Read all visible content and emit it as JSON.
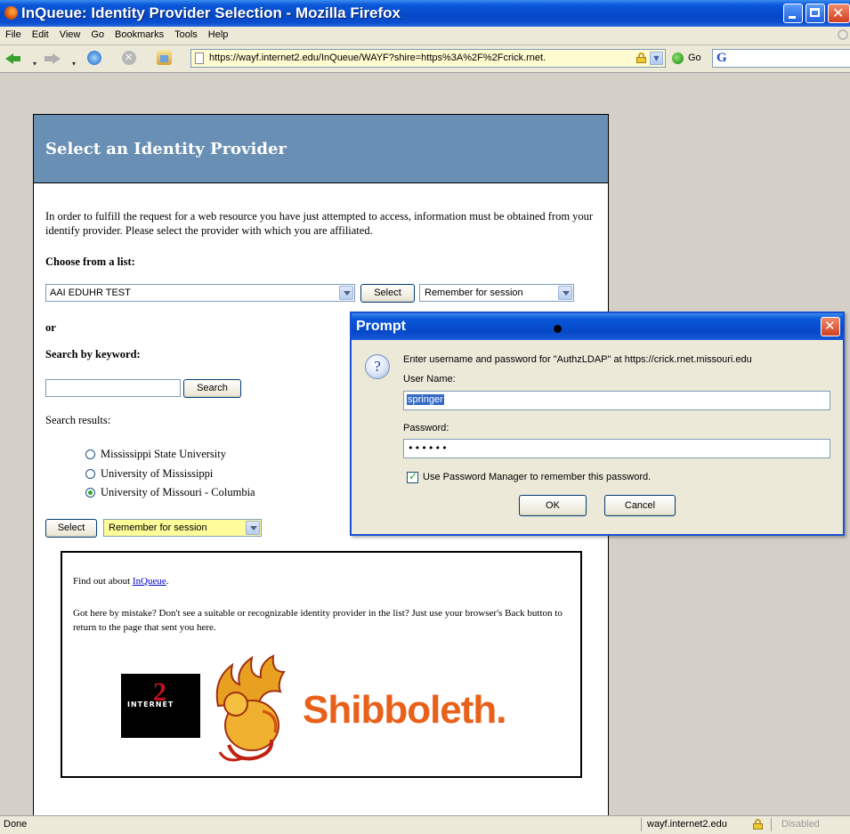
{
  "window": {
    "title": "InQueue: Identity Provider Selection - Mozilla Firefox"
  },
  "menu": [
    "File",
    "Edit",
    "View",
    "Go",
    "Bookmarks",
    "Tools",
    "Help"
  ],
  "toolbar": {
    "url": "https://wayf.internet2.edu/InQueue/WAYF?shire=https%3A%2F%2Fcrick.rnet.",
    "go_label": "Go"
  },
  "page": {
    "heading": "Select an Identity Provider",
    "intro": "In order to fulfill the request for a web resource you have just attempted to access, information must be obtained from your identify provider. Please select the provider with which you are affiliated.",
    "choose_heading": "Choose from a list:",
    "provider_selected": "AAI EDUHR TEST",
    "select_label": "Select",
    "remember_option": "Remember for session",
    "or_label": "or",
    "keyword_heading": "Search by keyword:",
    "keyword_value": "",
    "search_label": "Search",
    "results_label": "Search results:",
    "results": [
      "Mississippi State University",
      "University of Mississippi",
      "University of Missouri - Columbia"
    ],
    "selected_result_index": 2,
    "find_out_prefix": "Find out about ",
    "find_out_link": "InQueue",
    "find_out_suffix": ".",
    "mistake_text": "Got here by mistake? Don't see a suitable or recognizable identity provider in the list? Just use your browser's Back button to return to the page that sent you here.",
    "shibboleth_text": "Shibboleth.",
    "internet2_text": "INTERNET"
  },
  "prompt": {
    "title": "Prompt",
    "message": "Enter username and password for \"AuthzLDAP\" at https://crick.rnet.missouri.edu",
    "username_label": "User Name:",
    "username_value": "springer",
    "password_label": "Password:",
    "password_value": "••••••",
    "remember_checked": true,
    "remember_label": "Use Password Manager to remember this password.",
    "ok_label": "OK",
    "cancel_label": "Cancel"
  },
  "status": {
    "text": "Done",
    "domain": "wayf.internet2.edu",
    "popup_state": "Disabled"
  },
  "colors": {
    "header_blue": "#6a8fb5",
    "titlebar_blue": "#0548c8",
    "shibboleth_orange": "#e8601a",
    "highlight_yellow": "#fffd9a"
  },
  "icons": {
    "app": "firefox-icon",
    "back": "back-arrow-icon",
    "forward": "forward-arrow-icon",
    "reload": "reload-icon",
    "stop": "stop-icon",
    "home": "home-icon",
    "lock": "lock-icon",
    "question": "question-icon",
    "go": "go-icon",
    "search_engine": "google-icon"
  }
}
